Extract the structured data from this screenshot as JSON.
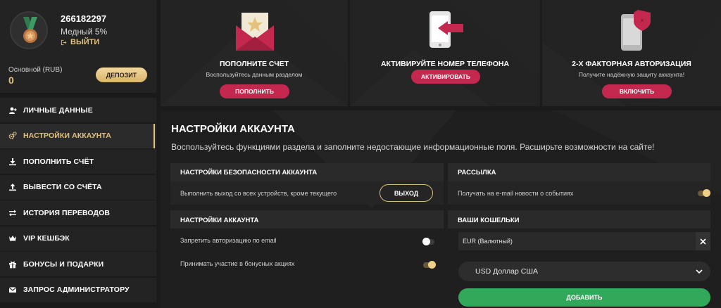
{
  "profile": {
    "user_id": "266182297",
    "level": "Медный 5%",
    "logout_label": "ВЫЙТИ",
    "balance_label": "Основной (RUB)",
    "balance_value": "0",
    "deposit_label": "ДЕПОЗИТ"
  },
  "menu": {
    "items": [
      {
        "label": "ЛИЧНЫЕ ДАННЫЕ",
        "icon": "user-plus-icon"
      },
      {
        "label": "НАСТРОЙКИ АККАУНТА",
        "icon": "gears-icon",
        "active": true
      },
      {
        "label": "ПОПОЛНИТЬ СЧЁТ",
        "icon": "download-icon"
      },
      {
        "label": "ВЫВЕСТИ СО СЧЁТА",
        "icon": "upload-icon"
      },
      {
        "label": "ИСТОРИЯ ПЕРЕВОДОВ",
        "icon": "transfer-arrows-icon"
      },
      {
        "label": "VIP КЕШБЭК",
        "icon": "crown-icon"
      },
      {
        "label": "БОНУСЫ И ПОДАРКИ",
        "icon": "gift-icon"
      },
      {
        "label": "ЗАПРОС АДМИНИСТРАТОРУ",
        "icon": "envelope-icon"
      }
    ]
  },
  "cards": {
    "deposit": {
      "title": "ПОПОЛНИТЕ СЧЕТ",
      "subtitle": "Воспользуйтесь данным разделом",
      "button": "ПОПОЛНИТЬ",
      "icon": "envelope-star-icon"
    },
    "phone": {
      "title": "АКТИВИРУЙТЕ НОМЕР ТЕЛЕФОНА",
      "button": "АКТИВИРОВАТЬ",
      "icon": "phone-arrow-icon"
    },
    "twofa": {
      "title": "2-Х ФАКТОРНАЯ АВТОРИЗАЦИЯ",
      "subtitle": "Получите надёжную защиту аккаунта!",
      "button": "ВКЛЮЧИТЬ",
      "icon": "phone-shield-icon"
    }
  },
  "main": {
    "title": "НАСТРОЙКИ АККАУНТА",
    "description": "Воспользуйтесь функциями раздела и заполните недостающие информационные поля. Расширьте возможности на сайте!",
    "security": {
      "heading": "НАСТРОЙКИ БЕЗОПАСНОСТИ АККАУНТА",
      "logout_all_label": "Выполнить выход со всех устройств, кроме текущего",
      "exit_button": "ВЫХОД"
    },
    "newsletter": {
      "heading": "РАССЫЛКА",
      "email_news_label": "Получать на e-mail новости о событиях",
      "email_news_on": true
    },
    "account": {
      "heading": "НАСТРОЙКИ АККАУНТА",
      "ban_email_auth_label": "Запретить авторизацию по email",
      "ban_email_auth_on": false,
      "bonus_label": "Принимать участие в бонусных акциях",
      "bonus_on": true
    },
    "wallets": {
      "heading": "ВАШИ КОШЕЛЬКИ",
      "wallet_value": "EUR (Валютный)",
      "currency_selected": "USD Доллар США",
      "add_button": "ДОБАВИТЬ"
    }
  },
  "colors": {
    "accent_gold": "#e3c27e",
    "button_red": "#c5284e",
    "button_green": "#32a85a"
  }
}
